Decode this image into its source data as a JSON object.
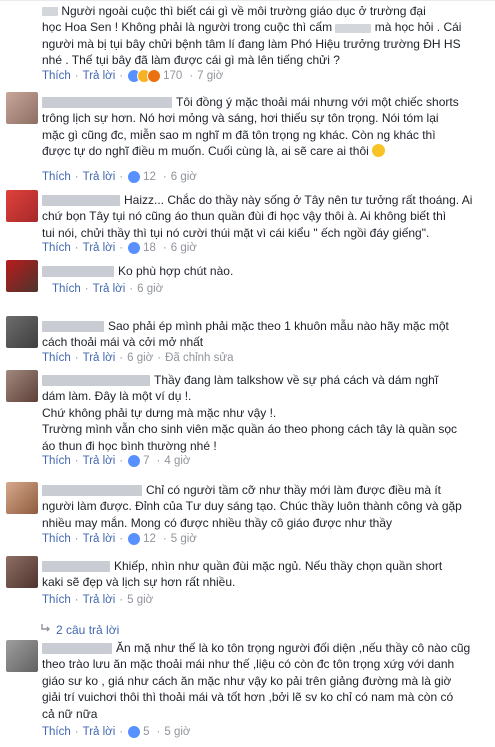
{
  "comments": [
    {
      "text": "Người ngoài cuộc thì biết cái gì về môi trường giáo dục ở trường đại học Hoa Sen ! Không phải là người trong cuộc thì cấm [redacted] mà học hỏi . Cái người mà bị tụi bây chửi bệnh tâm lí đang làm Phó Hiệu trưởng trường ĐH HS nhé . Thế tụi bây đã làm được cái gì mà lên tiếng chửi ?",
      "line1": "Người ngoài cuộc thì biết cái gì về môi trường giáo dục ở trường đại",
      "line2a": "học Hoa Sen ! Không phải là người trong cuộc thì cấm",
      "line2b": "mà học hỏi . Cái",
      "line3": "người mà bị tụi bây chửi bệnh tâm lí đang làm Phó Hiệu trưởng trường ĐH HS",
      "line4": "nhé . Thế tụi bây đã làm được cái gì mà lên tiếng chửi ?",
      "like": "Thích",
      "reply": "Trả lời",
      "reactions": "170",
      "time": "7 giờ"
    },
    {
      "line1": "Tôi đồng ý mặc thoải mái nhưng với một chiếc shorts",
      "line2": "trông lịch sự hơn. Nó hơi mỏng và sáng, hơi thiếu sự tôn trọng. Nói tóm lại",
      "line3": "mặc gì cũng đc, miễn sao m nghĩ m đã tôn trọng ng khác. Còn ng khác thì",
      "line4": "được tự do nghĩ điều m muốn. Cuối cùng là, ai sẽ care ai thôi",
      "like": "Thích",
      "reply": "Trả lời",
      "reactions": "12",
      "time": "6 giờ"
    },
    {
      "line1": "Haizz... Chắc do thầy này sống ở Tây nên tư tưởng rất thoáng. Ai",
      "line2": "chứ bọn Tây tụi nó cũng áo thun quần đùi đi học vậy thôi à. Ai không biết thì",
      "line3": "tui nói, chửi thầy thì tụi nó cười thúi mặt vì cái kiểu \" ếch ngồi đáy giếng\".",
      "like": "Thích",
      "reply": "Trả lời",
      "reactions": "18",
      "time": "6 giờ"
    },
    {
      "line1": "Ko phù hợp chút nào.",
      "like": "Thích",
      "reply": "Trả lời",
      "time": "6 giờ"
    },
    {
      "line1": "Sao phải ép mình phải mặc theo 1 khuôn mẫu nào hãy mặc một",
      "line2": "cách thoải mái và cởi mở nhất",
      "like": "Thích",
      "reply": "Trả lời",
      "time": "6 giờ",
      "edited": "Đã chỉnh sửa"
    },
    {
      "line1": "Thầy đang làm talkshow về sự phá cách và dám nghĩ",
      "line2": "dám làm. Đây là một ví dụ !.",
      "line3": "Chứ không phải tự dưng mà mặc như vậy !.",
      "line4": "Trường mình vẫn cho sinh viên mặc quần áo theo phong cách tây là quần sọc",
      "line5": "áo thun đi học bình thường nhé !",
      "like": "Thích",
      "reply": "Trả lời",
      "reactions": "7",
      "time": "4 giờ"
    },
    {
      "line1": "Chỉ có người tầm cỡ như thầy mới làm được điều mà ít",
      "line2": "người làm được. Đỉnh của Tư duy sáng tạo. Chúc thầy luôn thành công và gặp",
      "line3": "nhiều may mắn. Mong có được nhiều thầy cô giáo được như thầy",
      "like": "Thích",
      "reply": "Trả lời",
      "reactions": "12",
      "time": "5 giờ"
    },
    {
      "line1": "Khiếp, nhìn như quần đùi mặc ngủ. Nếu thầy chọn quần short",
      "line2": "kaki sẽ đẹp và lịch sự hơn rất nhiều.",
      "like": "Thích",
      "reply": "Trả lời",
      "time": "5 giờ"
    },
    {
      "line1": "Ăn mặ như thế là ko tôn trọng người đối diện ,nếu thầy cô nào cũg",
      "line2": "theo trào lưu ăn mặc thoải mái như thế ,liệu có còn đc tôn trọng xứg với danh",
      "line3": "giáo sư ko , giá như cách ăn mặc như vậy ko pải trên giảng đường mà là giờ",
      "line4": "giải trí vuichơi thôi thì thoải mái và tốt hơn ,bởi lẽ sv ko chỉ có nam mà còn có",
      "line5": "cả nữ nữa",
      "like": "Thích",
      "reply": "Trả lời",
      "reactions": "5",
      "time": "5 giờ"
    }
  ],
  "replies_toggle": {
    "label": "2 câu trả lời"
  },
  "colors": {
    "link": "#4267b2",
    "meta": "#90949c",
    "text": "#1d2129",
    "like": "#5890ff",
    "haha": "#f7b125",
    "angry": "#e9710f"
  }
}
